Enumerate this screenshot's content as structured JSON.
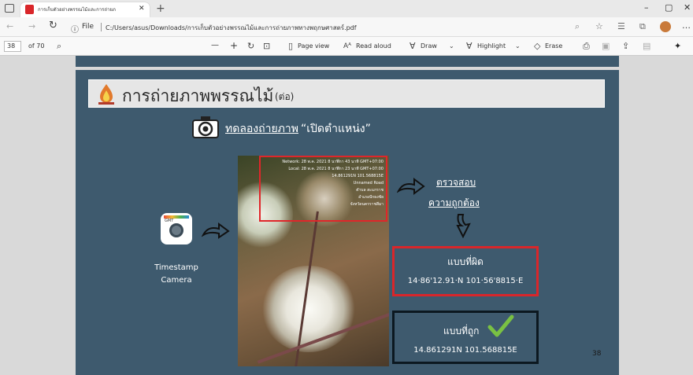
{
  "browser": {
    "tab_title": "การเก็บตัวอย่างพรรณไม้และการถ่ายภ",
    "new_tab_symbol": "+",
    "file_label": "File",
    "url": "C:/Users/asus/Downloads/การเก็บตัวอย่างพรรณไม้และการถ่ายภาพทางพฤกษศาสตร์.pdf",
    "window_min": "–",
    "window_max": "▢",
    "window_close": "✕"
  },
  "pdf_toolbar": {
    "page_current": "38",
    "page_total": "of 70",
    "zoom_out": "—",
    "zoom_in": "+",
    "page_view": "Page view",
    "read_aloud": "Read aloud",
    "draw": "Draw",
    "highlight": "Highlight",
    "erase": "Erase"
  },
  "slide": {
    "title": "การถ่ายภาพพรรณไม้",
    "title_suffix": "(ต่อ)",
    "subtitle_link": "ทดลองถ่ายภาพ",
    "subtitle_quote": "“เปิดตำแหน่ง”",
    "app_name_line1": "Timestamp",
    "app_name_line2": "Camera",
    "app_icon_text": "GMT",
    "check_line1": "ตรวจสอบ",
    "check_line2": "ความถูกต้อง",
    "wrong_label": "แบบที่ผิด",
    "wrong_value": "14·86'12.91·N  101·56'8815·E",
    "right_label": "แบบที่ถูก",
    "right_value": "14.861291N  101.568815E",
    "page_number": "38",
    "photo_overlay": [
      "Network: 28 พ.ค. 2021 8 นาฬิกา 43 นาที GMT+07:00",
      "Local: 28 พ.ค. 2021 8 นาฬิกา 23 นาที GMT+07:00",
      "14.861291N  101.568815E",
      "Unnamed Road",
      "ตำบล สะแกราช",
      "อำเภอปักธงชัย",
      "จังหวัดนครราชสีมา"
    ]
  },
  "colors": {
    "slide_bg": "#3e5a6e",
    "wrong_border": "#d9262a",
    "right_border": "#0c1820",
    "check_green": "#7ac143"
  }
}
